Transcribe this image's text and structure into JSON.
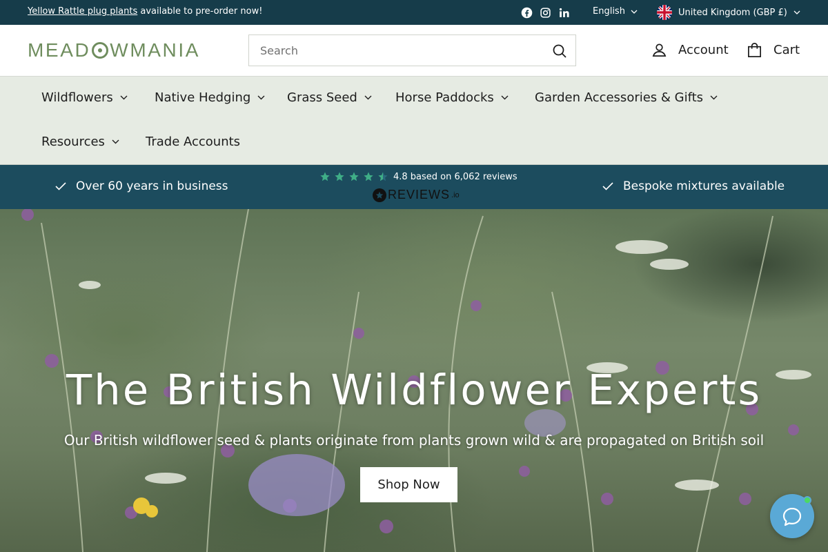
{
  "topbar": {
    "announce_link": "Yellow Rattle plug plants",
    "announce_text": " available to pre-order now!",
    "social": [
      "facebook-icon",
      "instagram-icon",
      "linkedin-icon"
    ],
    "language": "English",
    "currency": "United Kingdom (GBP £)"
  },
  "header": {
    "logo_part1": "MEAD",
    "logo_part2": "WMANIA",
    "search_placeholder": "Search",
    "account_label": "Account",
    "cart_label": "Cart"
  },
  "nav": {
    "items": [
      {
        "label": "Wildflowers",
        "dropdown": true
      },
      {
        "label": "Native Hedging",
        "dropdown": true
      },
      {
        "label": "Grass Seed",
        "dropdown": true
      },
      {
        "label": "Horse Paddocks",
        "dropdown": true
      },
      {
        "label": "Garden Accessories & Gifts",
        "dropdown": true
      },
      {
        "label": "Resources",
        "dropdown": true
      },
      {
        "label": "Trade Accounts",
        "dropdown": false
      }
    ]
  },
  "trust": {
    "left": "Over 60 years in business",
    "rating_text": "4.8 based on 6,062 reviews",
    "rating": 4.8,
    "reviews_brand": "REVIEWS",
    "reviews_suffix": ".io",
    "right": "Bespoke mixtures available"
  },
  "hero": {
    "title": "The British Wildflower Experts",
    "subtitle": "Our British wildflower seed & plants originate from plants grown wild & are propagated on British soil",
    "cta": "Shop Now"
  },
  "colors": {
    "topbar_bg": "#163c4a",
    "nav_bg": "#e6ebe3",
    "trust_bg": "#1c4c5e",
    "brand_green": "#6f8d5e",
    "star_green": "#3fae87",
    "chat_blue": "#5aa9d6"
  }
}
